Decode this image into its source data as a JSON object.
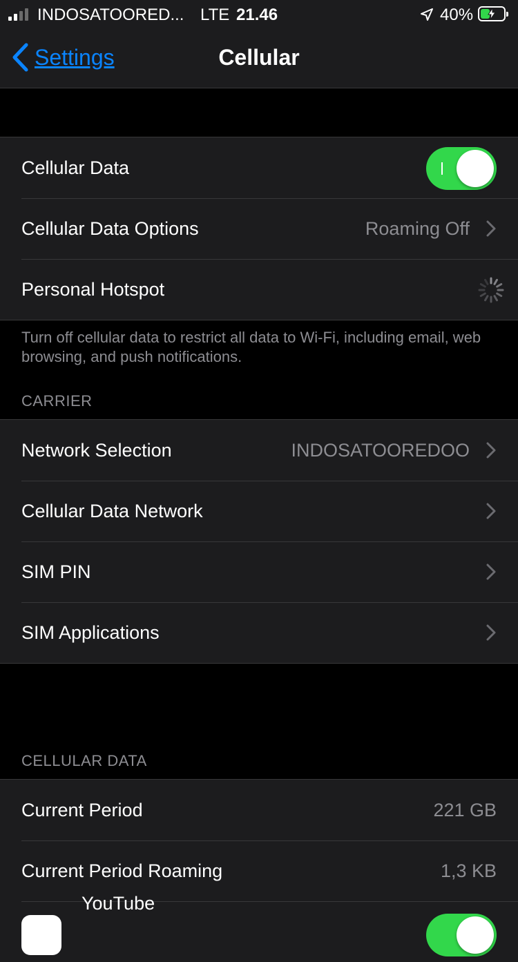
{
  "status_bar": {
    "carrier": "INDOSATOORED...",
    "network_type": "LTE",
    "time": "21.46",
    "battery_percent": "40%",
    "signal_bars_filled": 2,
    "battery_level": 0.4,
    "battery_color": "#32d74b"
  },
  "nav": {
    "back_label": "Settings",
    "title": "Cellular",
    "accent_color": "#0a84ff"
  },
  "main_group": {
    "cellular_data": {
      "label": "Cellular Data",
      "enabled": true
    },
    "data_options": {
      "label": "Cellular Data Options",
      "value": "Roaming Off"
    },
    "hotspot": {
      "label": "Personal Hotspot",
      "icon": "loading-spinner-icon"
    }
  },
  "footnote": "Turn off cellular data to restrict all data to Wi-Fi, including email, web browsing, and push notifications.",
  "carrier_section": {
    "header": "CARRIER",
    "items": [
      {
        "label": "Network Selection",
        "value": "INDOSATOOREDOO"
      },
      {
        "label": "Cellular Data Network",
        "value": ""
      },
      {
        "label": "SIM PIN",
        "value": ""
      },
      {
        "label": "SIM Applications",
        "value": ""
      }
    ]
  },
  "usage_section": {
    "header": "CELLULAR DATA",
    "current_period": {
      "label": "Current Period",
      "value": "221 GB"
    },
    "current_period_roaming": {
      "label": "Current Period Roaming",
      "value": "1,3 KB"
    },
    "app": {
      "label": "YouTube",
      "enabled": true
    }
  },
  "toggle_on_color": "#32d74b"
}
